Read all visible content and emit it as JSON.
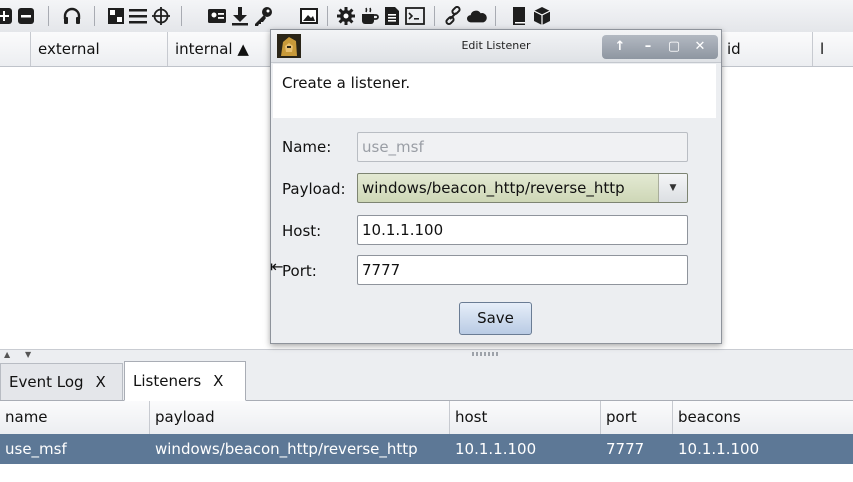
{
  "toolbar": {
    "items": [
      "plus-box-icon",
      "minus-box-icon",
      "headphones-icon",
      "target-grid-icon",
      "menu-lines-icon",
      "crosshair-icon",
      "credentials-icon",
      "download-icon",
      "key-icon",
      "screenshot-icon",
      "gear-icon",
      "coffee-icon",
      "document-icon",
      "terminal-icon",
      "link-icon",
      "cloud-icon",
      "book-icon",
      "package-icon"
    ]
  },
  "upper_table": {
    "columns": [
      "",
      "external",
      "internal ▲",
      "id",
      "l"
    ]
  },
  "dialog": {
    "title": "Edit Listener",
    "controls": [
      "↑",
      "–",
      "▢",
      "✕"
    ],
    "message": "Create a listener.",
    "name_label": "Name:",
    "name_value": "use_msf",
    "payload_label": "Payload:",
    "payload_value": "windows/beacon_http/reverse_http",
    "host_label": "Host:",
    "host_value": "10.1.1.100",
    "port_label": "Port:",
    "port_value": "7777",
    "save_label": "Save"
  },
  "bottom_tabs": [
    {
      "label": "Event Log",
      "close": "X"
    },
    {
      "label": "Listeners",
      "close": "X"
    }
  ],
  "listeners_table": {
    "columns": [
      "name",
      "payload",
      "host",
      "port",
      "beacons"
    ],
    "rows": [
      {
        "name": "use_msf",
        "payload": "windows/beacon_http/reverse_http",
        "host": "10.1.1.100",
        "port": "7777",
        "beacons": "10.1.1.100"
      }
    ]
  },
  "colors": {
    "selected_row": "#5d7896",
    "payload_select": "#d6dec2",
    "save_button": "#c9d8ec"
  }
}
